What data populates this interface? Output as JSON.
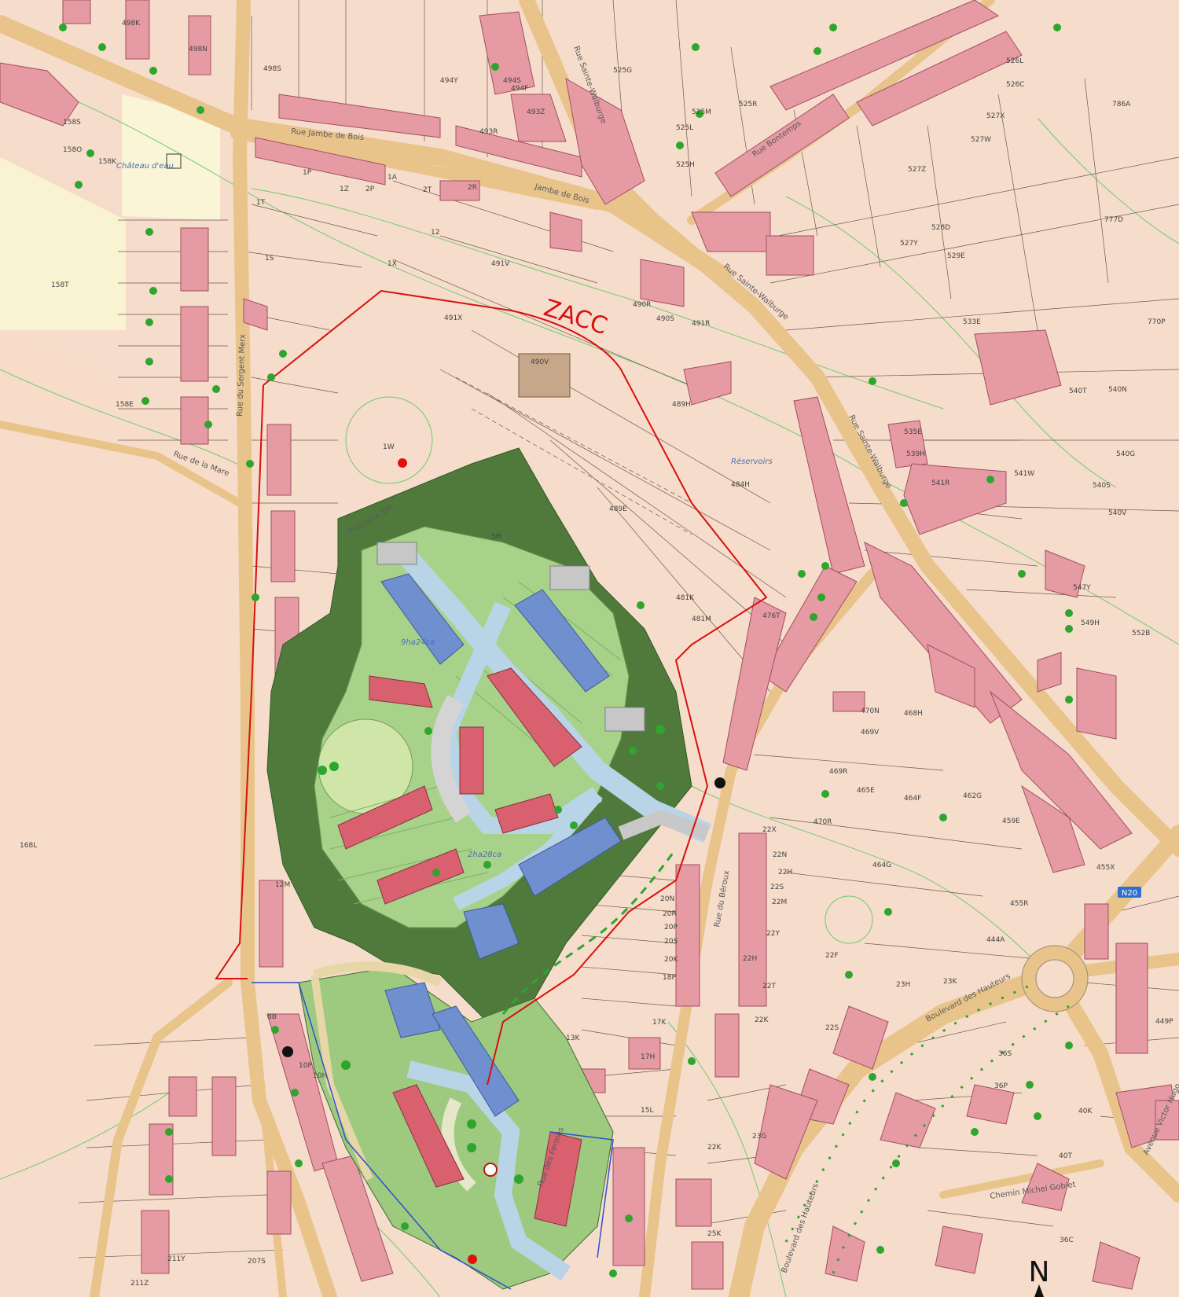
{
  "map": {
    "zone_label": "ZACC",
    "north_label": "N",
    "road_badge": "N20",
    "colors": {
      "background": "#f6dccb",
      "building": "#e69aa4",
      "zone_boundary": "#d81010",
      "green_buffer": "#4f7a3c",
      "garden": "#a8d18a",
      "project_building_red": "#d9606e",
      "project_building_blue": "#6f8fcf",
      "internal_road": "#b8d4e6",
      "tree": "#2ea52e"
    },
    "street_names": [
      {
        "id": "rue-jambe-de-bois",
        "text": "Rue Jambe de Bois"
      },
      {
        "id": "rue-jambe-de-bois-2",
        "text": "Jambe de Bois"
      },
      {
        "id": "rue-sainte-walburge-top",
        "text": "Rue Sainte-Walburge"
      },
      {
        "id": "rue-sainte-walburge-mid",
        "text": "Rue Sainte-Walburge"
      },
      {
        "id": "rue-sainte-walburge-right",
        "text": "Rue Sainte-Walburge"
      },
      {
        "id": "rue-bonne-espe",
        "text": "Rue Bontemps"
      },
      {
        "id": "rue-sergent-merx",
        "text": "Rue du Sergent Merx"
      },
      {
        "id": "rue-de-la-mare",
        "text": "Rue de la Mare"
      },
      {
        "id": "rue-du-beroux",
        "text": "Rue du Béroux"
      },
      {
        "id": "rue-des-fermes",
        "text": "Rue des Fermes"
      },
      {
        "id": "boulevard-hauteurs",
        "text": "Boulevard des Hauteurs"
      },
      {
        "id": "boulevard-hauteurs-2",
        "text": "Boulevard des Hauteurs"
      },
      {
        "id": "chemin-michel-gobiet",
        "text": "Chemin Michel Gobiet"
      },
      {
        "id": "avenue-victor",
        "text": "Avenue Victor Hugo"
      },
      {
        "id": "chateau",
        "text": "Château d'eau"
      },
      {
        "id": "reservoirs",
        "text": "Réservoirs"
      },
      {
        "id": "propriete",
        "text": "Propriété SPI"
      },
      {
        "id": "area-1",
        "text": "9ha24ca"
      },
      {
        "id": "area-2",
        "text": "2ha28ca"
      }
    ],
    "parcel_labels": [
      {
        "id": "p1",
        "text": "498K"
      },
      {
        "id": "p2",
        "text": "498N"
      },
      {
        "id": "p3",
        "text": "498S"
      },
      {
        "id": "p4",
        "text": "494Y"
      },
      {
        "id": "p5",
        "text": "494S"
      },
      {
        "id": "p6",
        "text": "494F"
      },
      {
        "id": "p7",
        "text": "493Z"
      },
      {
        "id": "p8",
        "text": "493R"
      },
      {
        "id": "p9",
        "text": "525G"
      },
      {
        "id": "p10",
        "text": "525R"
      },
      {
        "id": "p11",
        "text": "525L"
      },
      {
        "id": "p12",
        "text": "525M"
      },
      {
        "id": "p13",
        "text": "525H"
      },
      {
        "id": "p14",
        "text": "526L"
      },
      {
        "id": "p15",
        "text": "526C"
      },
      {
        "id": "p16",
        "text": "527X"
      },
      {
        "id": "p17",
        "text": "527W"
      },
      {
        "id": "p18",
        "text": "527Z"
      },
      {
        "id": "p19",
        "text": "528D"
      },
      {
        "id": "p20",
        "text": "527Y"
      },
      {
        "id": "p21",
        "text": "529E"
      },
      {
        "id": "p22",
        "text": "786A"
      },
      {
        "id": "p23",
        "text": "777D"
      },
      {
        "id": "p24",
        "text": "158O"
      },
      {
        "id": "p25",
        "text": "158S"
      },
      {
        "id": "p26",
        "text": "158K"
      },
      {
        "id": "p27",
        "text": "158T"
      },
      {
        "id": "p28",
        "text": "158E"
      },
      {
        "id": "p29",
        "text": "168L"
      },
      {
        "id": "p30",
        "text": "491V"
      },
      {
        "id": "p31",
        "text": "491X"
      },
      {
        "id": "p32",
        "text": "490V"
      },
      {
        "id": "p33",
        "text": "490R"
      },
      {
        "id": "p34",
        "text": "490S"
      },
      {
        "id": "p35",
        "text": "491R"
      },
      {
        "id": "p36",
        "text": "489H"
      },
      {
        "id": "p37",
        "text": "489E"
      },
      {
        "id": "p38",
        "text": "484H"
      },
      {
        "id": "p39",
        "text": "481K"
      },
      {
        "id": "p40",
        "text": "481M"
      },
      {
        "id": "p41",
        "text": "476T"
      },
      {
        "id": "p42",
        "text": "533E"
      },
      {
        "id": "p43",
        "text": "535E"
      },
      {
        "id": "p44",
        "text": "539H"
      },
      {
        "id": "p45",
        "text": "541R"
      },
      {
        "id": "p46",
        "text": "541W"
      },
      {
        "id": "p47",
        "text": "540S"
      },
      {
        "id": "p48",
        "text": "540V"
      },
      {
        "id": "p49",
        "text": "540G"
      },
      {
        "id": "p50",
        "text": "540N"
      },
      {
        "id": "p51",
        "text": "540T"
      },
      {
        "id": "p52",
        "text": "770P"
      },
      {
        "id": "p53",
        "text": "547Y"
      },
      {
        "id": "p54",
        "text": "549H"
      },
      {
        "id": "p55",
        "text": "552B"
      },
      {
        "id": "p56",
        "text": "470N"
      },
      {
        "id": "p57",
        "text": "469V"
      },
      {
        "id": "p58",
        "text": "468H"
      },
      {
        "id": "p59",
        "text": "469R"
      },
      {
        "id": "p60",
        "text": "465E"
      },
      {
        "id": "p61",
        "text": "464F"
      },
      {
        "id": "p62",
        "text": "462G"
      },
      {
        "id": "p63",
        "text": "459E"
      },
      {
        "id": "p64",
        "text": "464G"
      },
      {
        "id": "p65",
        "text": "455X"
      },
      {
        "id": "p66",
        "text": "455R"
      },
      {
        "id": "p67",
        "text": "444A"
      },
      {
        "id": "p68",
        "text": "470R"
      },
      {
        "id": "p69",
        "text": "22X"
      },
      {
        "id": "p70",
        "text": "22F"
      },
      {
        "id": "p71",
        "text": "23H"
      },
      {
        "id": "p72",
        "text": "23K"
      },
      {
        "id": "p73",
        "text": "22K"
      },
      {
        "id": "p74",
        "text": "22S"
      },
      {
        "id": "p75",
        "text": "22H"
      },
      {
        "id": "p76",
        "text": "23G"
      },
      {
        "id": "p77",
        "text": "36S"
      },
      {
        "id": "p78",
        "text": "36P"
      },
      {
        "id": "p79",
        "text": "40K"
      },
      {
        "id": "p80",
        "text": "40T"
      },
      {
        "id": "p81",
        "text": "36C"
      },
      {
        "id": "p82",
        "text": "449P"
      },
      {
        "id": "p83",
        "text": "20N"
      },
      {
        "id": "p84",
        "text": "20R"
      },
      {
        "id": "p85",
        "text": "20P"
      },
      {
        "id": "p86",
        "text": "20S"
      },
      {
        "id": "p87",
        "text": "20K"
      },
      {
        "id": "p88",
        "text": "18P"
      },
      {
        "id": "p89",
        "text": "17K"
      },
      {
        "id": "p90",
        "text": "17H"
      },
      {
        "id": "p91",
        "text": "13K"
      },
      {
        "id": "p92",
        "text": "15L"
      },
      {
        "id": "p93",
        "text": "22K"
      },
      {
        "id": "p94",
        "text": "25K"
      },
      {
        "id": "p95",
        "text": "12M"
      },
      {
        "id": "p96",
        "text": "8B"
      },
      {
        "id": "p97",
        "text": "10P"
      },
      {
        "id": "p98",
        "text": "10H"
      },
      {
        "id": "p99",
        "text": "211Y"
      },
      {
        "id": "p100",
        "text": "211Z"
      },
      {
        "id": "p101",
        "text": "207S"
      },
      {
        "id": "p102",
        "text": "1W"
      },
      {
        "id": "p103",
        "text": "5H"
      },
      {
        "id": "p104",
        "text": "1S"
      },
      {
        "id": "p105",
        "text": "1T"
      },
      {
        "id": "p106",
        "text": "1P"
      },
      {
        "id": "p107",
        "text": "2T"
      },
      {
        "id": "p108",
        "text": "2P"
      },
      {
        "id": "p109",
        "text": "1Z"
      },
      {
        "id": "p110",
        "text": "12"
      },
      {
        "id": "p111",
        "text": "2R"
      },
      {
        "id": "p112",
        "text": "1A"
      },
      {
        "id": "p113",
        "text": "1X"
      },
      {
        "id": "p114",
        "text": "22N"
      },
      {
        "id": "p115",
        "text": "22H"
      },
      {
        "id": "p116",
        "text": "22S"
      },
      {
        "id": "p117",
        "text": "22M"
      },
      {
        "id": "p118",
        "text": "22Y"
      },
      {
        "id": "p119",
        "text": "22T"
      }
    ]
  }
}
